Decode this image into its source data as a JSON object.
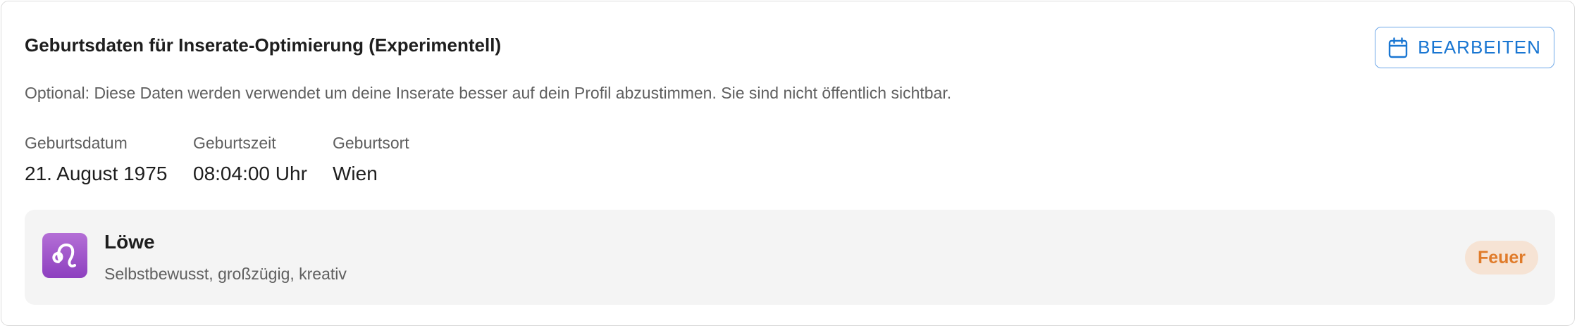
{
  "card": {
    "title": "Geburtsdaten für Inserate-Optimierung (Experimentell)",
    "edit_button": {
      "label": "BEARBEITEN",
      "icon": "calendar-icon"
    },
    "description": "Optional: Diese Daten werden verwendet um deine Inserate besser auf dein Profil abzustimmen. Sie sind nicht öffentlich sichtbar.",
    "fields": [
      {
        "label": "Geburtsdatum",
        "value": "21. August 1975"
      },
      {
        "label": "Geburtszeit",
        "value": "08:04:00 Uhr"
      },
      {
        "label": "Geburtsort",
        "value": "Wien"
      }
    ],
    "zodiac": {
      "icon": "leo-icon",
      "name": "Löwe",
      "traits": "Selbstbewusst, großzügig, kreativ",
      "element": "Feuer"
    }
  },
  "colors": {
    "accent": "#1976d2",
    "button_border": "#6fa8e8",
    "element_badge_bg": "#f6e3d4",
    "element_badge_text": "#e07b2a",
    "zodiac_icon_bg": "#9b4fc8",
    "panel_bg": "#f4f4f4"
  }
}
